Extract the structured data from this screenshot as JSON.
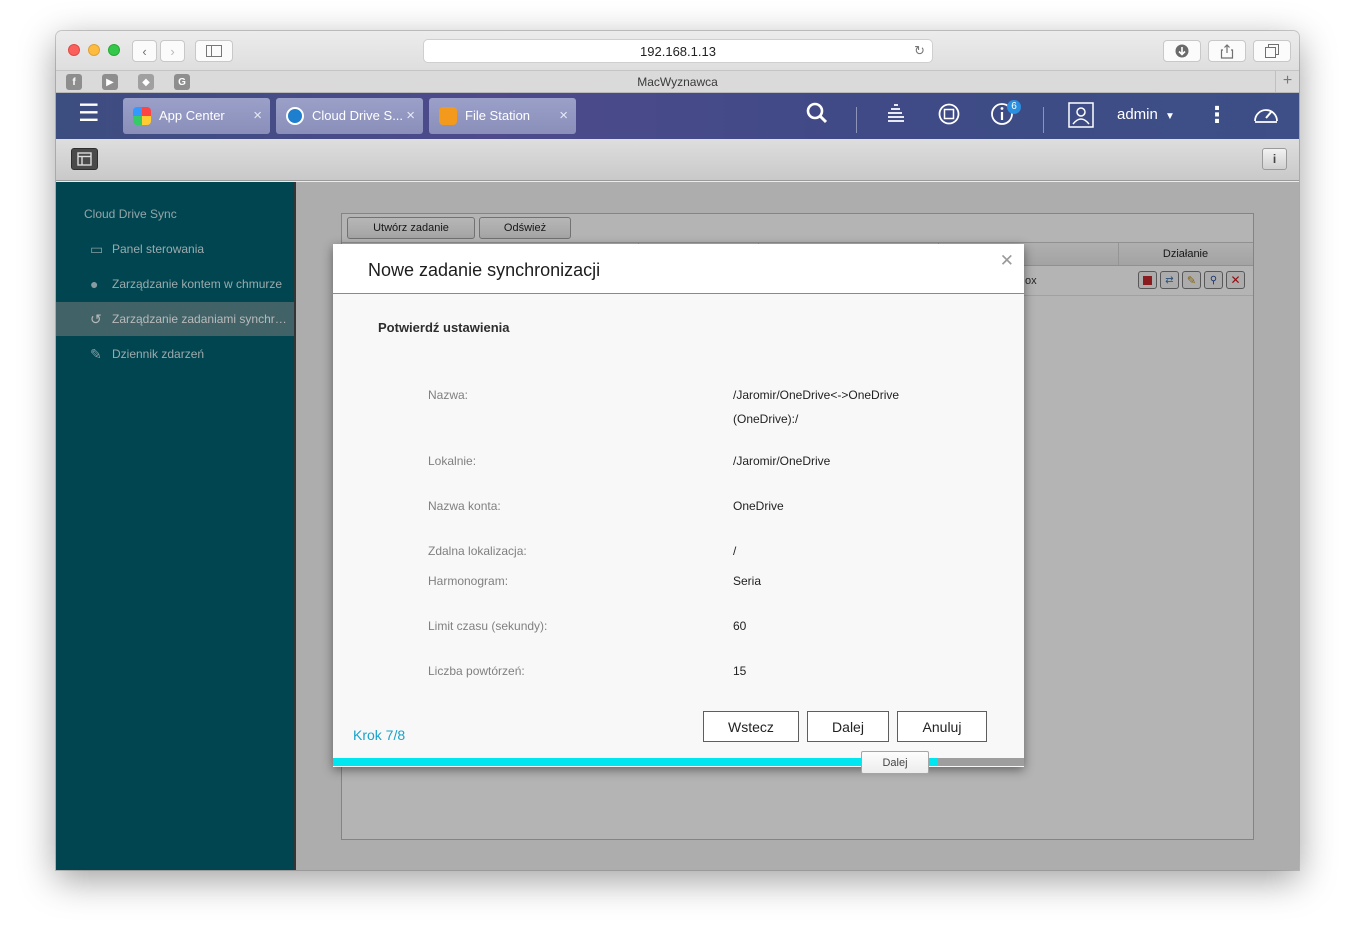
{
  "browser": {
    "address": "192.168.1.13",
    "tab_title": "MacWyznawca",
    "bookmarks": [
      "facebook-icon",
      "youtube-icon",
      "bookmark-icon",
      "google-icon"
    ]
  },
  "header": {
    "apps": [
      {
        "label": "App Center",
        "icon": "app-center-icon"
      },
      {
        "label": "Cloud Drive S...",
        "icon": "cloud-drive-icon"
      },
      {
        "label": "File Station",
        "icon": "file-station-icon"
      }
    ],
    "notification_count": "6",
    "user": "admin"
  },
  "sidebar": {
    "title": "Cloud Drive Sync",
    "items": [
      {
        "label": "Panel sterowania",
        "icon": "monitor-icon",
        "active": false
      },
      {
        "label": "Zarządzanie kontem w chmurze",
        "icon": "user-icon",
        "active": false
      },
      {
        "label": "Zarządzanie zadaniami synchronizacji",
        "icon": "history-icon",
        "active": true
      },
      {
        "label": "Dziennik zdarzeń",
        "icon": "log-icon",
        "active": false
      }
    ]
  },
  "panel": {
    "create_label": "Utwórz zadanie",
    "refresh_label": "Odśwież",
    "action_header": "Działanie",
    "row_fragment": "ox"
  },
  "modal": {
    "title": "Nowe zadanie synchronizacji",
    "subtitle": "Potwierdź ustawienia",
    "fields": [
      {
        "label": "Nazwa:",
        "value": "/Jaromir/OneDrive<->OneDrive (OneDrive):/"
      },
      {
        "label": "Lokalnie:",
        "value": "/Jaromir/OneDrive"
      },
      {
        "label": "Nazwa konta:",
        "value": "OneDrive"
      },
      {
        "label": "Zdalna lokalizacja:",
        "value": "/"
      },
      {
        "label": "Harmonogram:",
        "value": "Seria"
      },
      {
        "label": "Limit czasu (sekundy):",
        "value": "60"
      },
      {
        "label": "Liczba powtórzeń:",
        "value": "15"
      }
    ],
    "step": "Krok 7/8",
    "back_label": "Wstecz",
    "next_label": "Dalej",
    "cancel_label": "Anuluj",
    "progress": 0.875,
    "tooltip": "Dalej"
  },
  "colors": {
    "sidebar_bg": "#00606f",
    "accent": "#1aa3c9",
    "progress": "#00e6f0"
  }
}
